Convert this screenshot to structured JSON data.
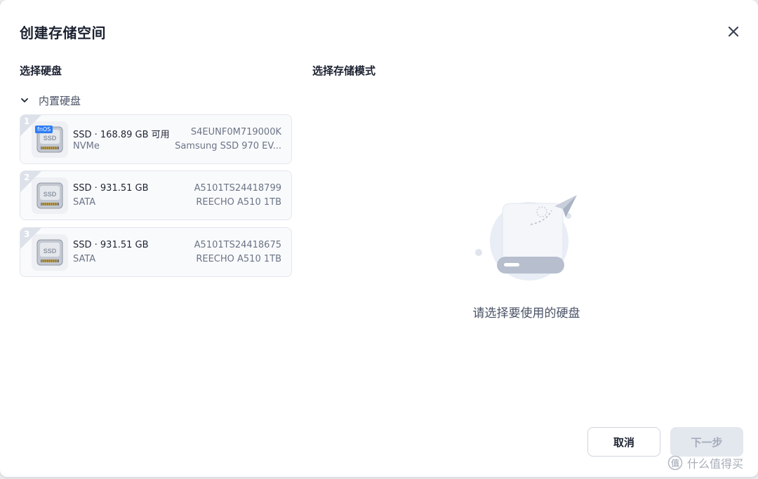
{
  "dialog": {
    "title": "创建存储空间",
    "left_section_title": "选择硬盘",
    "right_section_title": "选择存储模式",
    "group_label": "内置硬盘",
    "empty_text": "请选择要使用的硬盘",
    "cancel_label": "取消",
    "next_label": "下一步"
  },
  "disks": [
    {
      "index": "1",
      "line1": "SSD · 168.89 GB 可用",
      "line2": "NVMe",
      "serial": "S4EUNF0M719000K",
      "model": "Samsung SSD 970 EV...",
      "badge": "fnOS"
    },
    {
      "index": "2",
      "line1": "SSD · 931.51 GB",
      "line2": "SATA",
      "serial": "A5101TS24418799",
      "model": "REECHO A510 1TB"
    },
    {
      "index": "3",
      "line1": "SSD · 931.51 GB",
      "line2": "SATA",
      "serial": "A5101TS24418675",
      "model": "REECHO A510 1TB"
    }
  ],
  "ssd_icon_text": "SSD",
  "watermark": "什么值得买",
  "colors": {
    "accent": "#2d7cf6",
    "muted": "#6b7486"
  }
}
